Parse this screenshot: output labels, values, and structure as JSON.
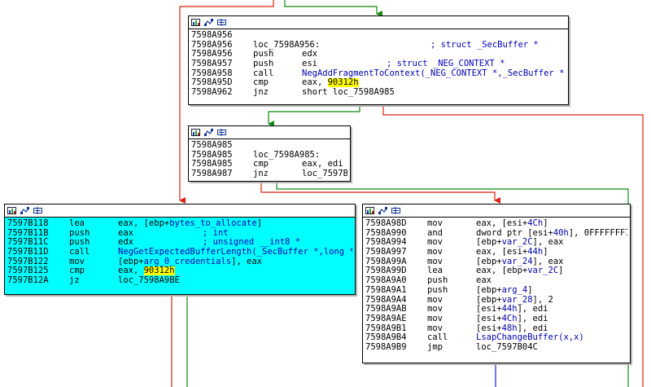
{
  "colors": {
    "edge_red": "#dd2211",
    "edge_green": "#118811",
    "edge_blue": "#1122cc",
    "highlight": "#ffff00",
    "node_selected": "#00ffff"
  },
  "header_icons": [
    "color-palette-icon",
    "graph-overview-icon",
    "node-rename-icon"
  ],
  "nodes": [
    {
      "id": "n1",
      "lines": [
        {
          "addr": "7598A956"
        },
        {
          "addr": "7598A956",
          "label": "loc_7598A956:",
          "comment": "; struct _SecBuffer *"
        },
        {
          "addr": "7598A956",
          "mn": "push",
          "op": "edx"
        },
        {
          "addr": "7598A957",
          "mn": "push",
          "op": "esi",
          "comment": "; struct _NEG_CONTEXT *"
        },
        {
          "addr": "7598A958",
          "mn": "call",
          "op": "NegAddFragmentToContext(_NEG_CONTEXT *,_SecBuffer *)",
          "opclass": "name"
        },
        {
          "addr": "7598A95D",
          "mn": "cmp",
          "op": "eax, ",
          "hl": "90312h"
        },
        {
          "addr": "7598A962",
          "mn": "jnz",
          "op": "short loc_7598A985"
        }
      ]
    },
    {
      "id": "n2",
      "lines": [
        {
          "addr": "7598A985"
        },
        {
          "addr": "7598A985",
          "label": "loc_7598A985:"
        },
        {
          "addr": "7598A985",
          "mn": "cmp",
          "op": "eax, edi"
        },
        {
          "addr": "7598A987",
          "mn": "jnz",
          "op": "loc_7597B172"
        }
      ]
    },
    {
      "id": "n3",
      "lines": [
        {
          "addr": "7597B118",
          "mn": "lea",
          "op": "eax, [ebp+",
          "opname": "bytes_to_allocate",
          "optail": "]"
        },
        {
          "addr": "7597B11B",
          "mn": "push",
          "op": "eax",
          "comment": "; int"
        },
        {
          "addr": "7597B11C",
          "mn": "push",
          "op": "edx",
          "comment": "; unsigned __int8 *"
        },
        {
          "addr": "7597B11D",
          "mn": "call",
          "op": "NegGetExpectedBufferLength(_SecBuffer *,long *)",
          "opclass": "name"
        },
        {
          "addr": "7597B122",
          "mn": "mov",
          "op": "[ebp+",
          "opname": "arg_0_credentials",
          "optail": "], eax"
        },
        {
          "addr": "7597B125",
          "mn": "cmp",
          "op": "eax, ",
          "hl": "90312h"
        },
        {
          "addr": "7597B12A",
          "mn": "jz",
          "op": "loc_7598A9BE"
        }
      ]
    },
    {
      "id": "n4",
      "lines": [
        {
          "addr": "7598A98D",
          "mn": "mov",
          "op": "eax, [esi+",
          "opname": "4Ch",
          "optail": "]"
        },
        {
          "addr": "7598A990",
          "mn": "and",
          "op": "dword ptr [esi+",
          "opname": "40h",
          "optail": "], 0FFFFFFF7h"
        },
        {
          "addr": "7598A994",
          "mn": "mov",
          "op": "[ebp+",
          "opname": "var_2C",
          "optail": "], eax"
        },
        {
          "addr": "7598A997",
          "mn": "mov",
          "op": "eax, [esi+",
          "opname": "44h",
          "optail": "]"
        },
        {
          "addr": "7598A99A",
          "mn": "mov",
          "op": "[ebp+",
          "opname": "var_24",
          "optail": "], eax"
        },
        {
          "addr": "7598A99D",
          "mn": "lea",
          "op": "eax, [ebp+",
          "opname": "var_2C",
          "optail": "]"
        },
        {
          "addr": "7598A9A0",
          "mn": "push",
          "op": "eax"
        },
        {
          "addr": "7598A9A1",
          "mn": "push",
          "op": "[ebp+",
          "opname": "arg_4",
          "optail": "]"
        },
        {
          "addr": "7598A9A4",
          "mn": "mov",
          "op": "[ebp+",
          "opname": "var_28",
          "optail": "], 2"
        },
        {
          "addr": "7598A9AB",
          "mn": "mov",
          "op": "[esi+",
          "opname": "44h",
          "optail": "], edi"
        },
        {
          "addr": "7598A9AE",
          "mn": "mov",
          "op": "[esi+",
          "opname": "4Ch",
          "optail": "], edi"
        },
        {
          "addr": "7598A9B1",
          "mn": "mov",
          "op": "[esi+",
          "opname": "48h",
          "optail": "], edi"
        },
        {
          "addr": "7598A9B4",
          "mn": "call",
          "op": "LsapChangeBuffer(x,x)",
          "opclass": "name"
        },
        {
          "addr": "7598A9B9",
          "mn": "jmp",
          "op": "loc_7597B04C"
        }
      ]
    }
  ]
}
